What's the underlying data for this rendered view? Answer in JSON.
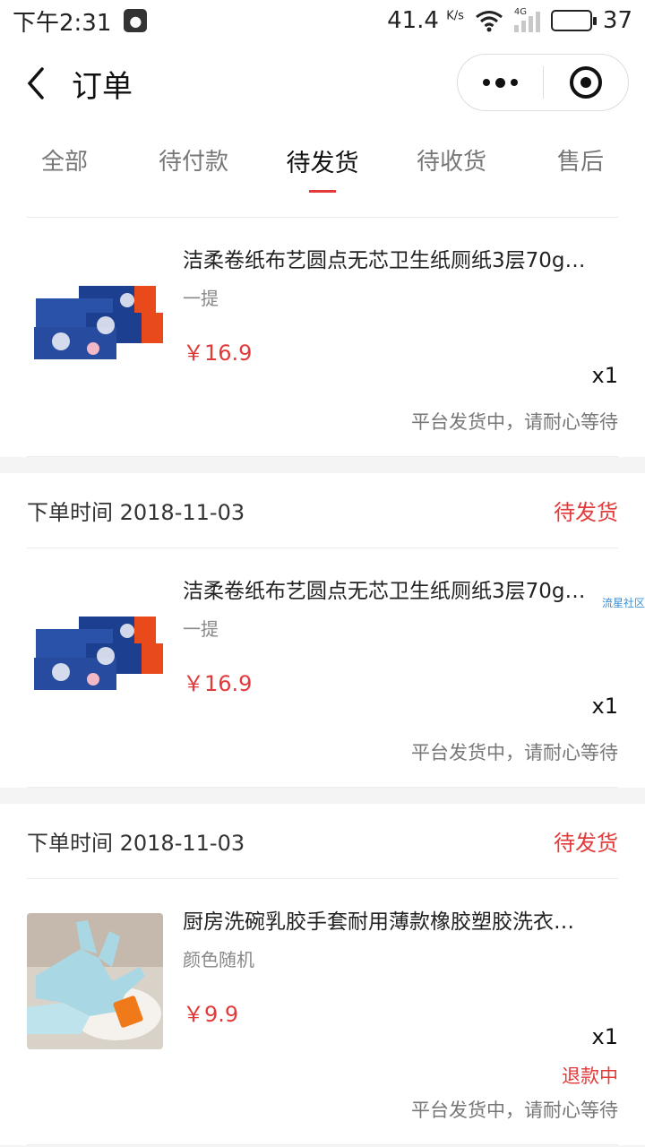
{
  "status_bar": {
    "time": "下午2:31",
    "speed": "41.4",
    "speed_unit": "K/s",
    "network": "4G",
    "battery": "37"
  },
  "navbar": {
    "title": "订单"
  },
  "tabs": [
    {
      "label": "全部"
    },
    {
      "label": "待付款"
    },
    {
      "label": "待发货"
    },
    {
      "label": "待收货"
    },
    {
      "label": "售后"
    }
  ],
  "orders": [
    {
      "items": [
        {
          "name": "洁柔卷纸布艺圆点无芯卫生纸厕纸3层70g…",
          "spec": "一提",
          "price": "￥16.9",
          "qty": "x1"
        }
      ],
      "footnote": "平台发货中，请耐心等待"
    },
    {
      "date": "下单时间 2018-11-03",
      "state": "待发货",
      "watermark": "流星社区",
      "items": [
        {
          "name": "洁柔卷纸布艺圆点无芯卫生纸厕纸3层70g…",
          "spec": "一提",
          "price": "￥16.9",
          "qty": "x1"
        }
      ],
      "footnote": "平台发货中，请耐心等待"
    },
    {
      "date": "下单时间 2018-11-03",
      "state": "待发货",
      "items": [
        {
          "name": "厨房洗碗乳胶手套耐用薄款橡胶塑胶洗衣…",
          "spec": "颜色随机",
          "price": "￥9.9",
          "qty": "x1",
          "refund": "退款中"
        }
      ],
      "footnote": "平台发货中，请耐心等待"
    }
  ],
  "colors": {
    "accent": "#e23a3a",
    "background": "#f4f4f4"
  }
}
